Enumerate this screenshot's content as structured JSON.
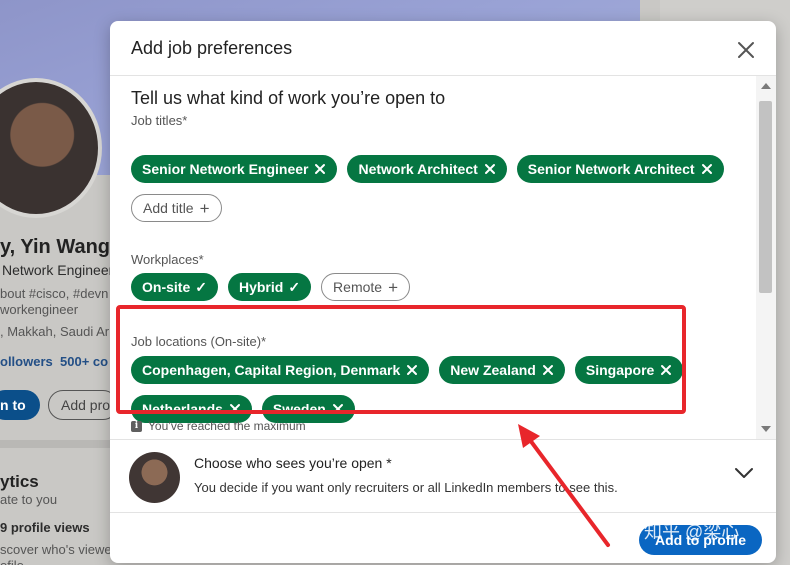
{
  "background": {
    "profile_name": "y, Yin Wang",
    "headline": "Network Engineer",
    "about_snippet": "bout #cisco, #devn",
    "about_tag": "workengineer",
    "location_snippet": ", Makkah, Saudi Ar",
    "followers": "ollowers",
    "connections": "500+ co",
    "open_button": "n to",
    "add_profile_button": "Add pro",
    "analytics_title": "ytics",
    "analytics_sub": "ate to you",
    "profile_views": "9 profile views",
    "discover": "scover who's viewe",
    "profile_tail": "ofile"
  },
  "modal": {
    "title": "Add job preferences",
    "heading": "Tell us what kind of work you’re open to",
    "job_titles_label": "Job titles*",
    "job_titles": [
      "Senior Network Engineer",
      "Network Architect",
      "Senior Network Architect"
    ],
    "add_title_label": "Add title",
    "workplaces_label": "Workplaces*",
    "workplaces_selected": [
      "On-site",
      "Hybrid"
    ],
    "workplace_unselected": "Remote",
    "locations_label": "Job locations (On-site)*",
    "locations_row1": [
      "Copenhagen, Capital Region, Denmark",
      "New Zealand",
      "Singapore"
    ],
    "locations_row2": [
      "Netherlands",
      "Sweden"
    ],
    "max_note": "You’ve reached the maximum",
    "info_icon_glyph": "i",
    "visibility_title": "Choose who sees you’re open *",
    "visibility_subtitle": "You decide if you want only recruiters or all LinkedIn members to see this.",
    "add_button": "Add to profile"
  },
  "watermark": "知乎 @梁心",
  "colors": {
    "green": "#057642",
    "blue": "#0a66c2",
    "highlight_red": "#e8262b"
  }
}
